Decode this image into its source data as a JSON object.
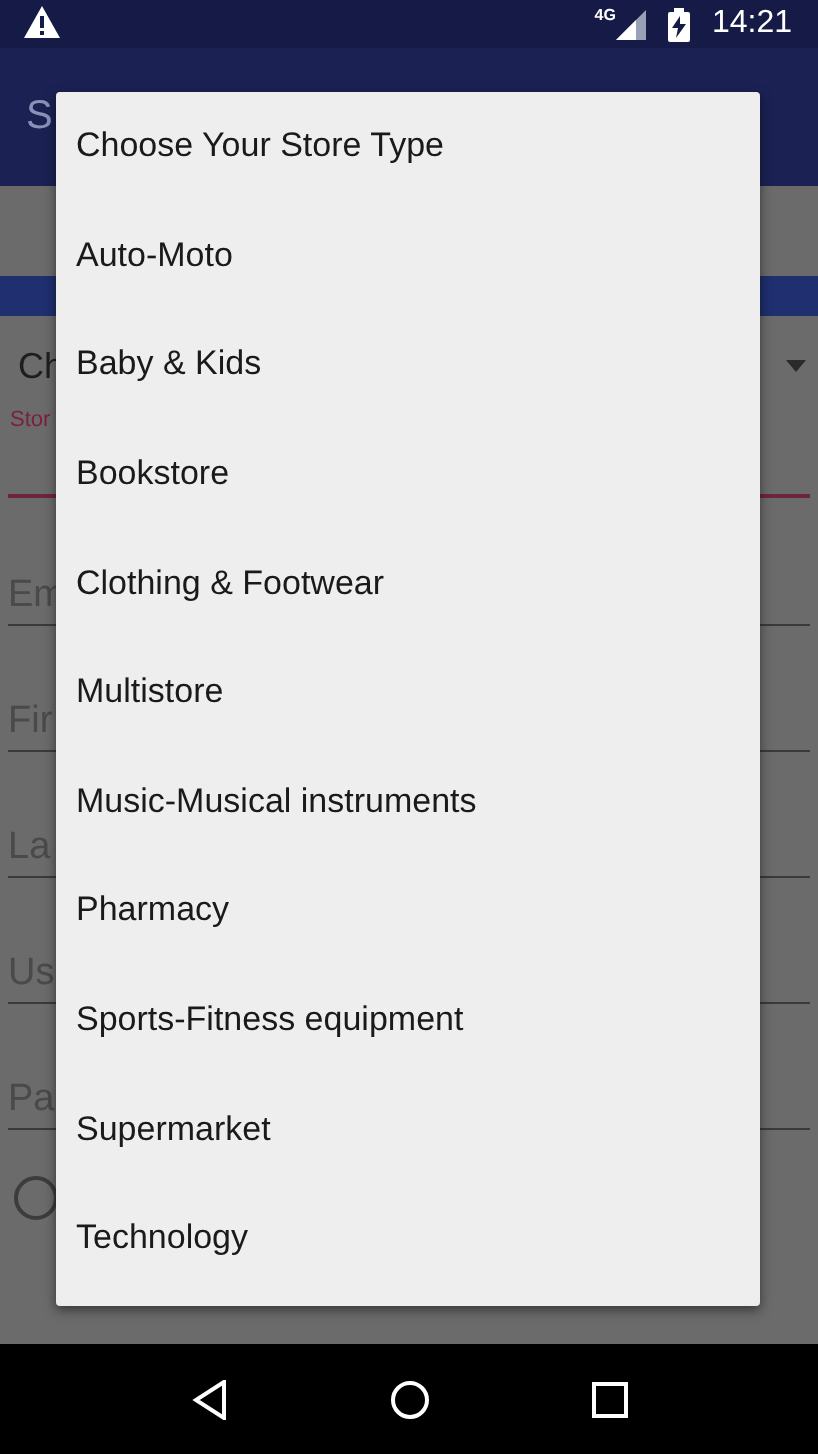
{
  "status_bar": {
    "network": "4G",
    "time": "14:21"
  },
  "app_bar": {
    "title": "S"
  },
  "form": {
    "store_type": {
      "value": "Ch",
      "label": "Stor"
    },
    "fields": [
      {
        "placeholder": "Em"
      },
      {
        "placeholder": "Fir"
      },
      {
        "placeholder": "La"
      },
      {
        "placeholder": "Us"
      },
      {
        "placeholder": "Pa"
      }
    ],
    "radio": {
      "checked": false
    }
  },
  "dialog": {
    "items": [
      {
        "label": "Choose Your Store Type"
      },
      {
        "label": "Auto-Moto"
      },
      {
        "label": "Baby & Kids"
      },
      {
        "label": "Bookstore"
      },
      {
        "label": "Clothing & Footwear"
      },
      {
        "label": "Multistore"
      },
      {
        "label": "Music-Musical instruments"
      },
      {
        "label": "Pharmacy"
      },
      {
        "label": "Sports-Fitness equipment"
      },
      {
        "label": "Supermarket"
      },
      {
        "label": "Technology"
      }
    ]
  }
}
